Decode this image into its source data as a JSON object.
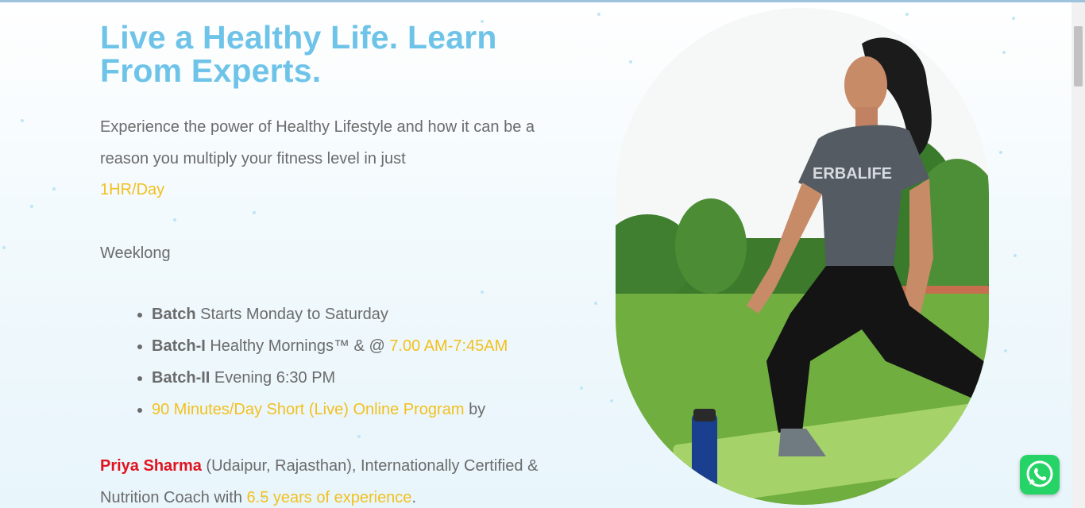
{
  "hero": {
    "headline_line1": "Live a Healthy Life. Learn",
    "headline_line2": "From Experts.",
    "intro": "Experience the power of Healthy Lifestyle and how it can be a reason you multiply your fitness level  in just",
    "intro_highlight": "1HR/Day",
    "weeklong": "Weeklong"
  },
  "batches": [
    {
      "bold": "Batch",
      "text": "Starts Monday to Saturday",
      "highlight": ""
    },
    {
      "bold": "Batch-I",
      "text": "Healthy Mornings™ & @",
      "highlight": "7.00 AM-7:45AM"
    },
    {
      "bold": "Batch-II",
      "text": "Evening 6:30 PM",
      "highlight": ""
    },
    {
      "bold": "",
      "highlight_lead": "90 Minutes/Day Short (Live) Online Program",
      "text": "by"
    }
  ],
  "coach": {
    "name": "Priya Sharma",
    "desc_1": "(Udaipur, Rajasthan), Internationally Certified & Nutrition Coach with",
    "experience": "6.5  years of experience",
    "desc_end": "."
  },
  "photo": {
    "shirt_text": "ERBALIFE"
  },
  "colors": {
    "headline": "#6ec3e8",
    "highlight_yellow": "#f2c01e",
    "name_red": "#e0141e",
    "whatsapp": "#25d366"
  },
  "icons": {
    "whatsapp": "whatsapp-icon"
  }
}
